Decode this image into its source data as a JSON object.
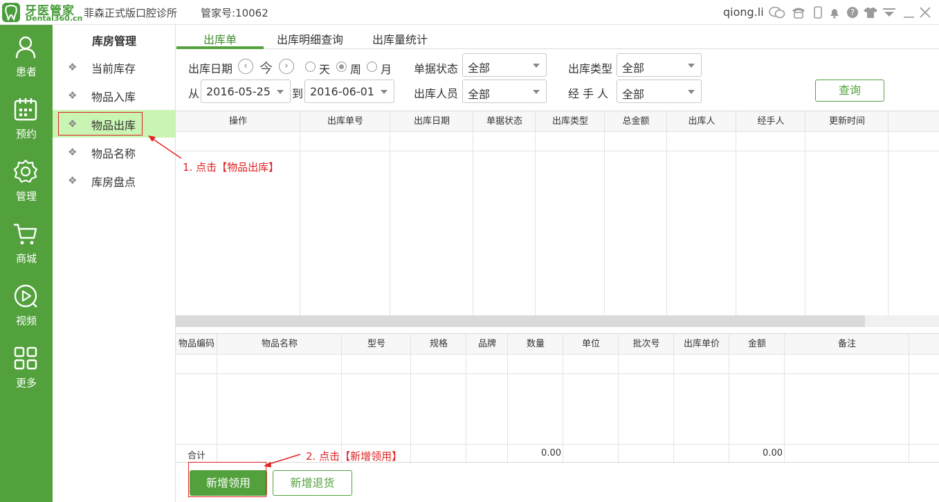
{
  "app": {
    "logo_cn": "牙医管家",
    "logo_en": "Dental360.cn",
    "clinic_name": "菲森正式版口腔诊所",
    "account_no": "管家号:10062",
    "username": "qiong.li"
  },
  "rail": [
    {
      "label": "患者",
      "icon": "user-icon"
    },
    {
      "label": "预约",
      "icon": "calendar-icon"
    },
    {
      "label": "管理",
      "icon": "gear-icon"
    },
    {
      "label": "商城",
      "icon": "cart-icon"
    },
    {
      "label": "视频",
      "icon": "play-icon"
    },
    {
      "label": "更多",
      "icon": "grid-icon"
    }
  ],
  "subnav": {
    "title": "库房管理",
    "items": [
      {
        "label": "当前库存"
      },
      {
        "label": "物品入库"
      },
      {
        "label": "物品出库"
      },
      {
        "label": "物品名称"
      },
      {
        "label": "库房盘点"
      }
    ]
  },
  "tabs": [
    {
      "label": "出库单"
    },
    {
      "label": "出库明细查询"
    },
    {
      "label": "出库量统计"
    }
  ],
  "filters": {
    "date_label": "出库日期",
    "today": "今",
    "day": "天",
    "week": "周",
    "month": "月",
    "from_label": "从",
    "to_label": "到",
    "from_date": "2016-05-25",
    "to_date": "2016-06-01",
    "status_label": "单据状态",
    "status_value": "全部",
    "type_label": "出库类型",
    "type_value": "全部",
    "person_label": "出库人员",
    "person_value": "全部",
    "handler_label": "经 手 人",
    "handler_value": "全部",
    "query_label": "查询"
  },
  "main_table": {
    "headers": [
      "操作",
      "出库单号",
      "出库日期",
      "单据状态",
      "出库类型",
      "总金额",
      "出库人",
      "经手人",
      "更新时间"
    ]
  },
  "detail_table": {
    "headers": [
      "物品编码",
      "物品名称",
      "型号",
      "规格",
      "品牌",
      "数量",
      "单位",
      "批次号",
      "出库单价",
      "金额",
      "备注"
    ],
    "total_label": "合计",
    "total_qty": "0.00",
    "total_amount": "0.00"
  },
  "buttons": {
    "new_issue": "新增领用",
    "new_return": "新增退货"
  },
  "annotations": {
    "step1": "1. 点击【物品出库】",
    "step2": "2. 点击【新增领用】",
    "color": "#e02020"
  },
  "colors": {
    "brand_green": "#52a13c",
    "active_nav_bg": "#c9f4b3"
  }
}
